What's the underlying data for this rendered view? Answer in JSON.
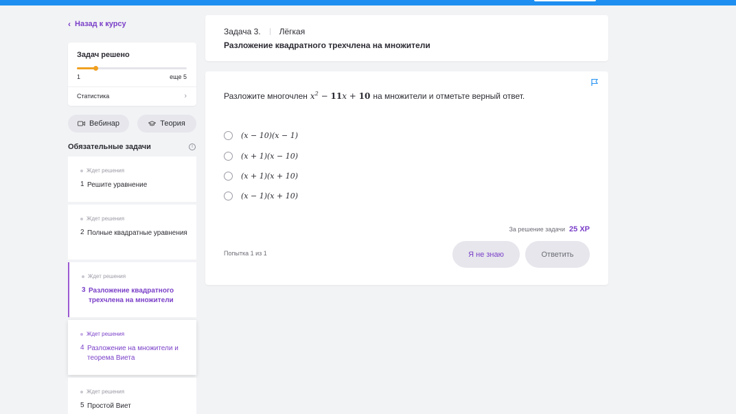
{
  "sidebar": {
    "back_label": "Назад к курсу",
    "progress": {
      "title": "Задач решено",
      "solved": "1",
      "remaining": "еще 5",
      "fraction": 0.17
    },
    "stats_label": "Статистика",
    "webinar_label": "Вебинар",
    "theory_label": "Теория",
    "section_title": "Обязательные задачи",
    "tasks": [
      {
        "status": "Ждет решения",
        "num": "1",
        "name": "Решите уравнение"
      },
      {
        "status": "Ждет решения",
        "num": "2",
        "name": "Полные квадратные уравнения"
      },
      {
        "status": "Ждет решения",
        "num": "3",
        "name": "Разложение квадратного трехчлена на множители"
      },
      {
        "status": "Ждет решения",
        "num": "4",
        "name": "Разложение на множители и теорема Виета"
      },
      {
        "status": "Ждет решения",
        "num": "5",
        "name": "Простой Виет"
      }
    ]
  },
  "header": {
    "task_label": "Задача 3.",
    "difficulty": "Лёгкая",
    "title": "Разложение квадратного трехчлена на множители"
  },
  "task": {
    "question_before": "Разложите многочлен",
    "question_after": "на множители и отметьте верный ответ.",
    "options": [
      "(x − 10)(x − 1)",
      "(x + 1)(x − 10)",
      "(x + 1)(x + 10)",
      "(x − 1)(x + 10)"
    ],
    "reward_label": "За решение задачи",
    "reward_xp": "25 XP",
    "attempt": "Попытка 1 из 1",
    "dontknow_label": "Я не знаю",
    "answer_label": "Ответить"
  },
  "colors": {
    "accent": "#7a3fc8",
    "topbar": "#1e8ff0",
    "progress": "#f0a020"
  }
}
